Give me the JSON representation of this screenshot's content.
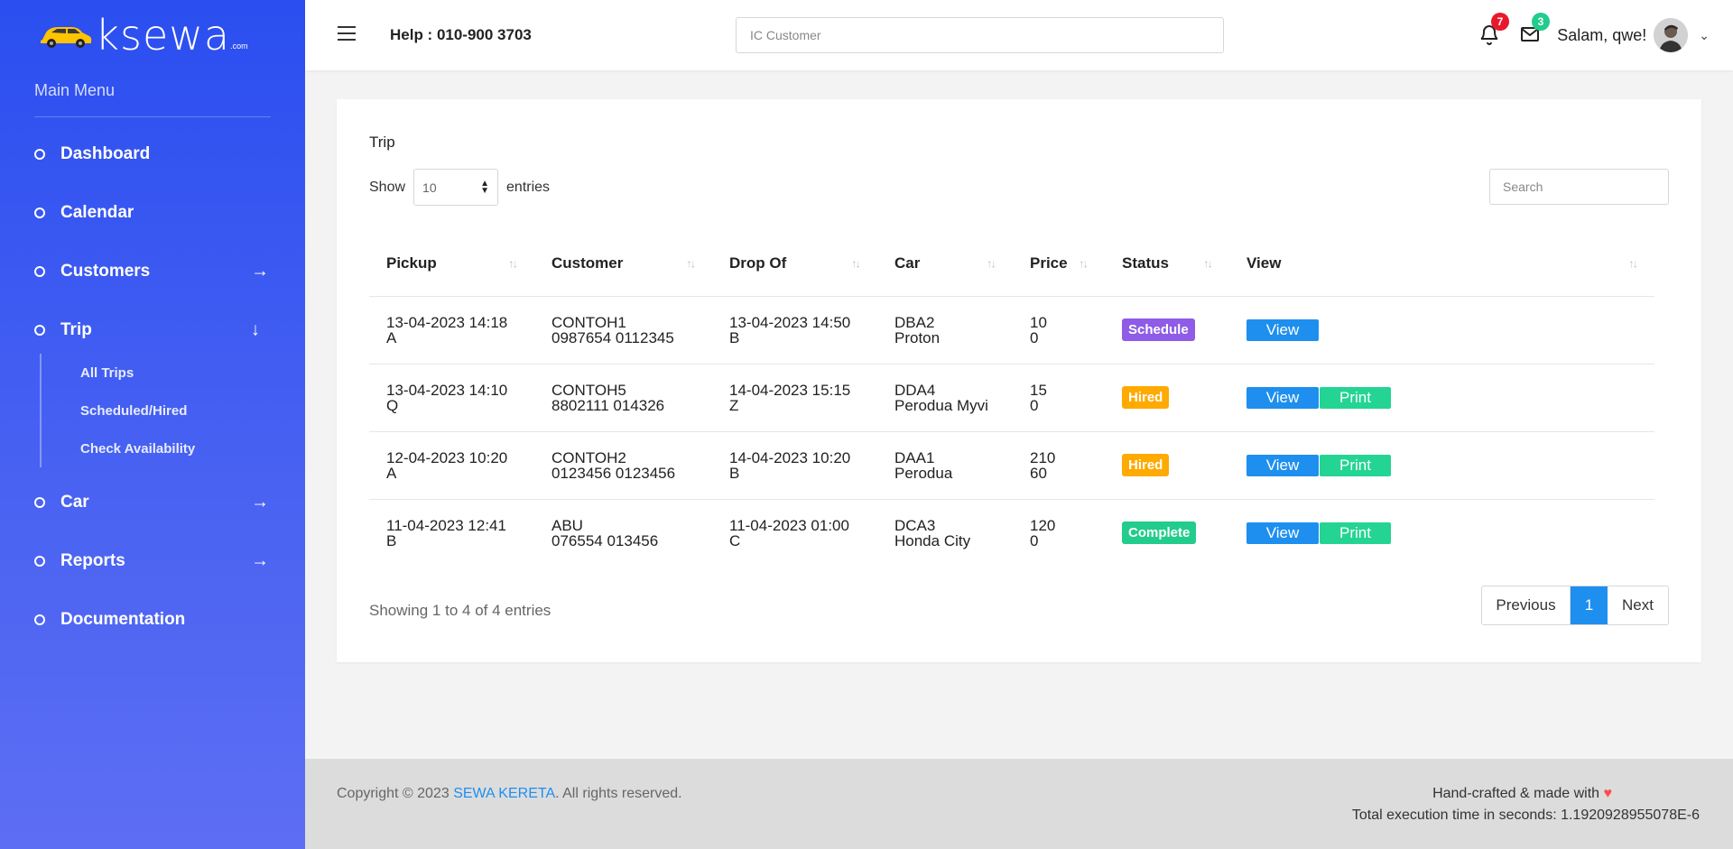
{
  "brand": {
    "logo_text": "ksewa",
    "dotcom": ".com"
  },
  "sidebar": {
    "menu_title": "Main Menu",
    "items": [
      {
        "label": "Dashboard",
        "arrow": ""
      },
      {
        "label": "Calendar",
        "arrow": ""
      },
      {
        "label": "Customers",
        "arrow": "→"
      },
      {
        "label": "Trip",
        "arrow": "↓"
      },
      {
        "label": "Car",
        "arrow": "→"
      },
      {
        "label": "Reports",
        "arrow": "→"
      },
      {
        "label": "Documentation",
        "arrow": ""
      }
    ],
    "trip_sub": [
      "All Trips",
      "Scheduled/Hired",
      "Check Availability"
    ]
  },
  "topbar": {
    "help": "Help : 010-900 3703",
    "search_placeholder": "IC Customer",
    "notifications_count": "7",
    "messages_count": "3",
    "greeting": "Salam, qwe!"
  },
  "card": {
    "title": "Trip",
    "show_label": "Show",
    "entries_label": "entries",
    "entries_value": "10",
    "search_placeholder": "Search",
    "columns": [
      "Pickup",
      "Customer",
      "Drop Of",
      "Car",
      "Price",
      "Status",
      "View"
    ],
    "rows": [
      {
        "pickup": "13-04-2023 14:18",
        "pickup_loc": "A",
        "customer": "CONTOH1",
        "customer_ids": "0987654   0112345",
        "drop": "13-04-2023 14:50",
        "drop_loc": "B",
        "car": "DBA2",
        "car_model": "Proton",
        "price": "10",
        "price2": "0",
        "status": "Schedule",
        "status_color": "#8e5ce6",
        "view": "View",
        "print": ""
      },
      {
        "pickup": "13-04-2023 14:10",
        "pickup_loc": "Q",
        "customer": "CONTOH5",
        "customer_ids": "8802111   014326",
        "drop": "14-04-2023 15:15",
        "drop_loc": "Z",
        "car": "DDA4",
        "car_model": "Perodua Myvi",
        "price": "15",
        "price2": "0",
        "status": "Hired",
        "status_color": "#ffaa00",
        "view": "View",
        "print": "Print"
      },
      {
        "pickup": "12-04-2023 10:20",
        "pickup_loc": "A",
        "customer": "CONTOH2",
        "customer_ids": "0123456   0123456",
        "drop": "14-04-2023 10:20",
        "drop_loc": "B",
        "car": "DAA1",
        "car_model": "Perodua",
        "price": "210",
        "price2": "60",
        "status": "Hired",
        "status_color": "#ffaa00",
        "view": "View",
        "print": "Print"
      },
      {
        "pickup": "11-04-2023 12:41",
        "pickup_loc": "B",
        "customer": "ABU",
        "customer_ids": "076554   013456",
        "drop": "11-04-2023 01:00",
        "drop_loc": "C",
        "car": "DCA3",
        "car_model": "Honda City",
        "price": "120",
        "price2": "0",
        "status": "Complete",
        "status_color": "#22cc8c",
        "view": "View",
        "print": "Print"
      }
    ],
    "showing": "Showing 1 to 4 of 4 entries",
    "pager": {
      "prev": "Previous",
      "page": "1",
      "next": "Next"
    }
  },
  "footer": {
    "copyright_prefix": "Copyright © 2023 ",
    "company": "SEWA KERETA",
    "copyright_suffix": ". All rights reserved.",
    "made": "Hand-crafted & made with",
    "heart": "♥",
    "exec": "Total execution time in seconds: 1.1920928955078E-6"
  },
  "colors": {
    "sidebar_top": "#2b4ef0",
    "accent": "#1e8fef",
    "print": "#24d493",
    "notif_badge": "#e8192c",
    "msg_badge": "#22cc8c"
  }
}
